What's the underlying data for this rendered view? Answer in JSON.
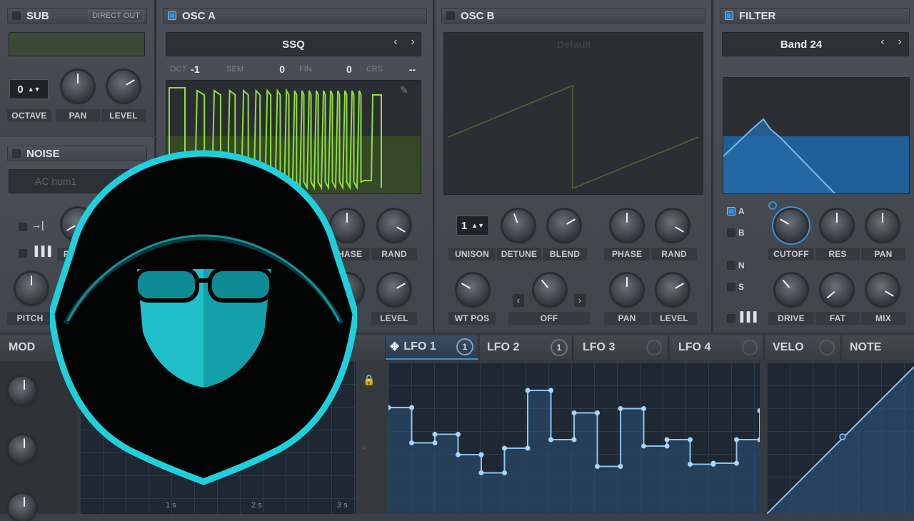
{
  "sub": {
    "title": "SUB",
    "direct_out": "DIRECT OUT",
    "octave_value": "0",
    "octave_label": "OCTAVE",
    "pan_label": "PAN",
    "level_label": "LEVEL"
  },
  "noise": {
    "title": "NOISE",
    "preset": "AC hum1",
    "phase_label": "PHASE",
    "pitch_label": "PITCH"
  },
  "osc_a": {
    "title": "OSC A",
    "wavetable": "SSQ",
    "oct_label": "OCT",
    "oct_value": "-1",
    "sem_label": "SEM",
    "sem_value": "0",
    "fin_label": "FIN",
    "fin_value": "0",
    "crs_label": "CRS",
    "crs_value": "--",
    "phase_label": "PHASE",
    "rand_label": "RAND",
    "level_label": "LEVEL"
  },
  "osc_b": {
    "title": "OSC B",
    "wavetable": "Default",
    "unison_value": "1",
    "unison_label": "UNISON",
    "detune_label": "DETUNE",
    "blend_label": "BLEND",
    "phase_label": "PHASE",
    "rand_label": "RAND",
    "wtpos_label": "WT POS",
    "off_label": "OFF",
    "pan_label": "PAN",
    "level_label": "LEVEL"
  },
  "filter": {
    "title": "FILTER",
    "type": "Band 24",
    "route_a": "A",
    "route_b": "B",
    "route_n": "N",
    "route_s": "S",
    "cutoff_label": "CUTOFF",
    "res_label": "RES",
    "pan_label": "PAN",
    "drive_label": "DRIVE",
    "fat_label": "FAT",
    "mix_label": "MIX"
  },
  "mod": {
    "title": "MOD",
    "lfo_tabs": [
      {
        "label": "LFO 1",
        "count": "1"
      },
      {
        "label": "LFO 2",
        "count": "1"
      },
      {
        "label": "LFO 3",
        "count": ""
      },
      {
        "label": "LFO 4",
        "count": ""
      }
    ],
    "velo_label": "VELO",
    "note_label": "NOTE",
    "time_labels": [
      "1 s",
      "2 s",
      "3 s"
    ]
  },
  "lfo1_points": [
    [
      0,
      0.22
    ],
    [
      1,
      0.22
    ],
    [
      1,
      0.55
    ],
    [
      2,
      0.55
    ],
    [
      2,
      0.47
    ],
    [
      3,
      0.47
    ],
    [
      3,
      0.66
    ],
    [
      4,
      0.66
    ],
    [
      4,
      0.83
    ],
    [
      5,
      0.83
    ],
    [
      5,
      0.6
    ],
    [
      6,
      0.6
    ],
    [
      6,
      0.06
    ],
    [
      7,
      0.06
    ],
    [
      7,
      0.52
    ],
    [
      8,
      0.52
    ],
    [
      8,
      0.27
    ],
    [
      9,
      0.27
    ],
    [
      9,
      0.77
    ],
    [
      10,
      0.77
    ],
    [
      10,
      0.23
    ],
    [
      11,
      0.23
    ],
    [
      11,
      0.58
    ],
    [
      12,
      0.58
    ],
    [
      12,
      0.52
    ],
    [
      13,
      0.52
    ],
    [
      13,
      0.75
    ],
    [
      14,
      0.75
    ],
    [
      14,
      0.74
    ],
    [
      15,
      0.74
    ],
    [
      15,
      0.52
    ],
    [
      16,
      0.52
    ],
    [
      16,
      0.25
    ]
  ],
  "colors": {
    "accent": "#3b8fd6",
    "wave_green": "#8ee03a",
    "lfo_line": "#8fc4f0",
    "logo_cyan": "#1fd0dc"
  }
}
